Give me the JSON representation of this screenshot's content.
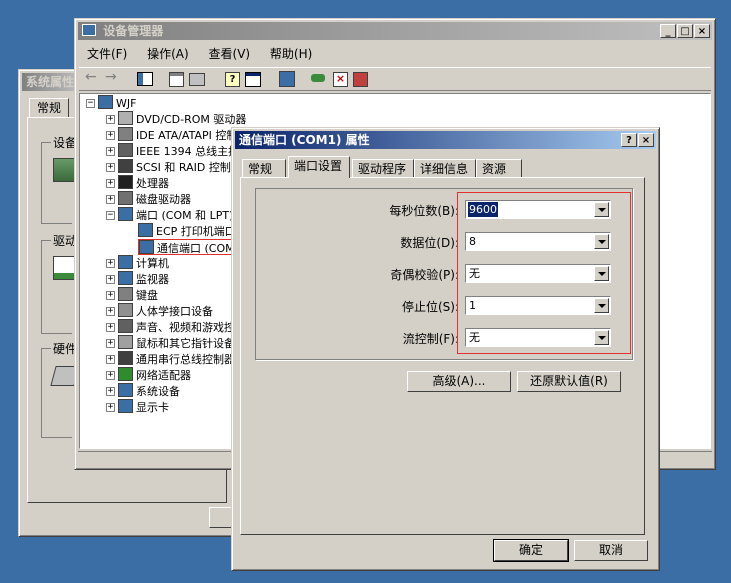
{
  "sysprops": {
    "title": "系统属性",
    "tab": "常规",
    "groups": [
      "设备",
      "驱动",
      "硬件"
    ]
  },
  "devmgr": {
    "title": "设备管理器",
    "menu": [
      "文件(F)",
      "操作(A)",
      "查看(V)",
      "帮助(H)"
    ],
    "root": "WJF",
    "tree": [
      "DVD/CD-ROM 驱动器",
      "IDE ATA/ATAPI 控制器",
      "IEEE 1394 总线主控器",
      "SCSI 和 RAID 控制器",
      "处理器",
      "磁盘驱动器",
      "端口 (COM 和 LPT)",
      "ECP 打印机端口",
      "通信端口 (COM1)",
      "计算机",
      "监视器",
      "键盘",
      "人体学接口设备",
      "声音、视频和游戏控制器",
      "鼠标和其它指针设备",
      "通用串行总线控制器",
      "网络适配器",
      "系统设备",
      "显示卡"
    ]
  },
  "dialog": {
    "title": "通信端口 (COM1) 属性",
    "help": "?",
    "close": "×",
    "tabs": [
      "常规",
      "端口设置",
      "驱动程序",
      "详细信息",
      "资源"
    ],
    "fields": [
      {
        "label": "每秒位数(B):",
        "value": "9600"
      },
      {
        "label": "数据位(D):",
        "value": "8"
      },
      {
        "label": "奇偶校验(P):",
        "value": "无"
      },
      {
        "label": "停止位(S):",
        "value": "1"
      },
      {
        "label": "流控制(F):",
        "value": "无"
      }
    ],
    "advanced": "高级(A)...",
    "restore": "还原默认值(R)",
    "ok": "确定",
    "cancel": "取消"
  },
  "highlight_color": "#e03030",
  "accent_color": "#0a246a"
}
